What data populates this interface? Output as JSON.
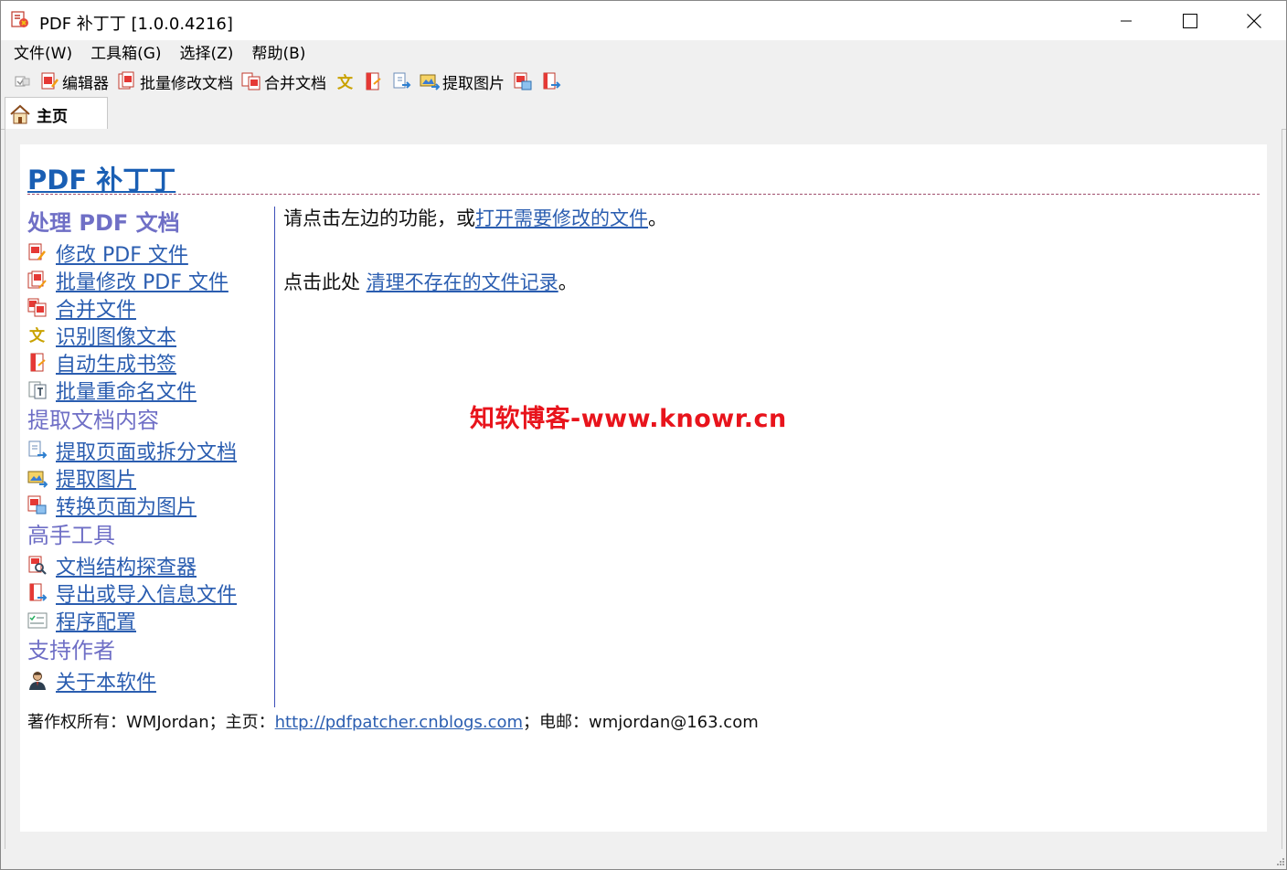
{
  "window": {
    "title": "PDF 补丁丁 [1.0.0.4216]"
  },
  "menu": [
    "文件(W)",
    "工具箱(G)",
    "选择(Z)",
    "帮助(B)"
  ],
  "toolbar": {
    "editor": "编辑器",
    "batch_modify": "批量修改文档",
    "merge": "合并文档",
    "extract_images": "提取图片"
  },
  "tab": {
    "label": "主页"
  },
  "content": {
    "title": "PDF 补丁丁",
    "sections": [
      {
        "heading": "处理 PDF 文档",
        "links": [
          "修改 PDF 文件",
          "批量修改 PDF 文件",
          "合并文件",
          "识别图像文本",
          "自动生成书签",
          "批量重命名文件"
        ]
      },
      {
        "heading": "提取文档内容",
        "links": [
          "提取页面或拆分文档",
          "提取图片",
          "转换页面为图片"
        ]
      },
      {
        "heading": "高手工具",
        "links": [
          "文档结构探查器",
          "导出或导入信息文件",
          "程序配置"
        ]
      },
      {
        "heading": "支持作者",
        "links": [
          "关于本软件"
        ]
      }
    ],
    "intro_prefix": "请点击左边的功能，或",
    "intro_link": "打开需要修改的文件",
    "intro_suffix": "。",
    "cleanup_prefix": "点击此处 ",
    "cleanup_link": "清理不存在的文件记录",
    "cleanup_suffix": "。",
    "watermark": "知软博客-www.knowr.cn",
    "footer_prefix": "著作权所有：WMJordan；主页：",
    "footer_link": "http://pdfpatcher.cnblogs.com",
    "footer_suffix": "；电邮：wmjordan@163.com"
  },
  "colors": {
    "link": "#2a5db0",
    "section_heading": "#6f6fc6",
    "title": "#1a5fb4",
    "watermark": "#e8141c"
  },
  "icons": {
    "app": "pdf-patcher-app-icon",
    "pdf": "pdf-document-icon",
    "merge": "merge-documents-icon",
    "ocr": "ocr-text-icon",
    "bookmark": "bookmark-icon",
    "rename": "rename-icon",
    "extract_pages": "extract-pages-icon",
    "images": "images-icon",
    "convert": "convert-to-image-icon",
    "inspector": "inspector-icon",
    "export": "export-import-icon",
    "config": "config-icon",
    "about": "person-icon",
    "home": "home-icon"
  }
}
